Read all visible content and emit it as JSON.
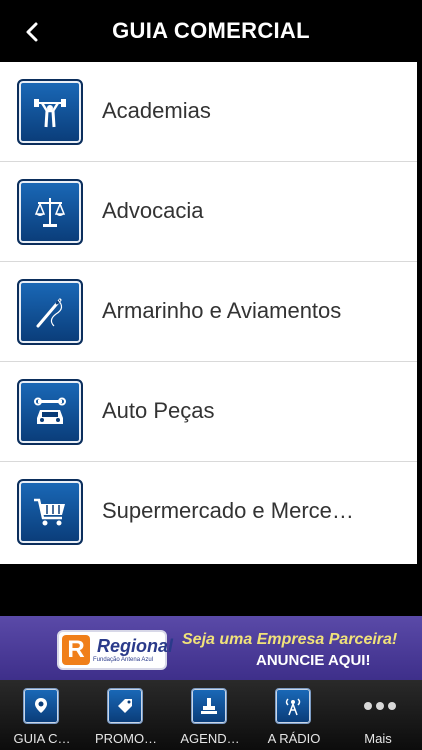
{
  "header": {
    "title": "GUIA COMERCIAL",
    "back_icon": "chevron-left-icon"
  },
  "list": {
    "items": [
      {
        "label": "Academias",
        "icon": "weightlifter-icon"
      },
      {
        "label": "Advocacia",
        "icon": "scales-icon"
      },
      {
        "label": "Armarinho e Aviamentos",
        "icon": "needle-icon"
      },
      {
        "label": "Auto Peças",
        "icon": "car-wrench-icon"
      },
      {
        "label": "Supermercado e Merce…",
        "icon": "shopping-cart-icon"
      }
    ]
  },
  "banner": {
    "logo_letter": "R",
    "logo_name": "Regional",
    "logo_sub": "Fundação Antena Azul",
    "line1": "Seja uma Empresa Parceira!",
    "line2": "ANUNCIE AQUI!"
  },
  "tabbar": {
    "tabs": [
      {
        "label": "GUIA C…",
        "icon": "map-pin-icon"
      },
      {
        "label": "PROMO…",
        "icon": "price-tag-icon"
      },
      {
        "label": "AGEND…",
        "icon": "stamp-icon"
      },
      {
        "label": "A RÁDIO",
        "icon": "radio-tower-icon"
      },
      {
        "label": "Mais",
        "icon": "more-dots-icon"
      }
    ]
  },
  "colors": {
    "accent": "#0a3c78",
    "banner": "#4a3a98",
    "header": "#000000"
  }
}
